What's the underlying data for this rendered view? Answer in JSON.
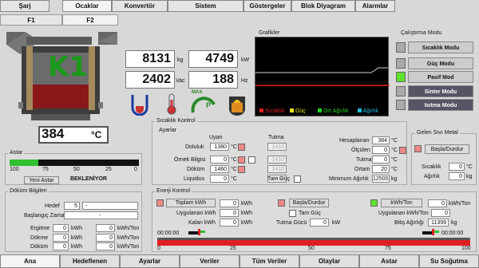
{
  "top_tabs": [
    "Şarj",
    "Ocaklar",
    "Konvertör",
    "Sistem",
    "Göstergeler",
    "Blok Diyagram",
    "Alarmlar"
  ],
  "sub_tabs": [
    "F1",
    "F2"
  ],
  "furnace": {
    "label": "K1",
    "temp": "384",
    "temp_unit": "°C"
  },
  "readouts": {
    "r1": "8131",
    "u1": "kg",
    "r2": "4749",
    "u2": "kW",
    "r3": "2402",
    "u3": "Vac",
    "r4": "188",
    "u4": "Hz"
  },
  "icon_labels": {
    "max": "MAX",
    "p": "P"
  },
  "graphics": {
    "title": "Grafikler",
    "legend": [
      "Sıcaklık",
      "Güç",
      "Ort.Ağırlık",
      "Ağırlık"
    ]
  },
  "mode": {
    "title": "Çalıştırma Modu",
    "buttons": [
      "Sıcaklık Modu",
      "Güç Modu",
      "Pasif Mod",
      "Sinter Modu",
      "Isıtma Modu"
    ]
  },
  "astar": {
    "title": "Astar",
    "ticks": [
      "100",
      "75",
      "50",
      "25",
      "0"
    ],
    "btn": "Yeni Astar",
    "status": "BEKLENİYOR"
  },
  "temp_ctrl": {
    "title": "Sıcaklık Kontrol",
    "sub": "Ayarlar",
    "col1": "Uyarı",
    "col2": "Tutma",
    "rows": [
      {
        "label": "Doluluk",
        "v1": "1380",
        "u": "°C",
        "v2": "1410"
      },
      {
        "label": "Örnek Bilgisi",
        "v1": "0",
        "u": "°C",
        "v2": "1410"
      },
      {
        "label": "Döküm",
        "v1": "1460",
        "u": "°C",
        "v2": "1410"
      },
      {
        "label": "Liquidus",
        "v1": "0",
        "u": "°C",
        "v2": "1410"
      }
    ],
    "right": [
      {
        "label": "Hesaplanan",
        "v": "384",
        "u": "°C"
      },
      {
        "label": "Ölçülen",
        "v": "0",
        "u": "°C"
      },
      {
        "label": "Tutma",
        "v": "0",
        "u": "°C"
      },
      {
        "label": "Ortam",
        "v": "20",
        "u": "°C"
      },
      {
        "label": "Minimum Ağırlık",
        "v": "12500",
        "u": "kg"
      }
    ],
    "tam_guc": "Tam Güç"
  },
  "liquid": {
    "title": "Gelen Sıvı Metal",
    "btn": "Başla/Durdur",
    "sicaklik": "Sıcaklık",
    "sic_v": "0",
    "sic_u": "°C",
    "agirlik": "Ağırlık",
    "ag_v": "0",
    "ag_u": "kg"
  },
  "dokum": {
    "title": "Döküm Bilgileri",
    "hedef": "Hedef",
    "hedef_v": "5",
    "hedef_d": "-",
    "baslangic": "Başlangıç Zamanı",
    "baslangic_d": "-",
    "rows": [
      {
        "label": "Ergitme",
        "v1": "0",
        "u1": "kWh",
        "v2": "0",
        "u2": "kWh/Ton"
      },
      {
        "label": "Dökme",
        "v1": "0",
        "u1": "kWh",
        "v2": "0",
        "u2": "kWh/Ton"
      },
      {
        "label": "Döküm",
        "v1": "0",
        "u1": "kWh",
        "v2": "0",
        "u2": "kWh/Ton"
      }
    ]
  },
  "energy": {
    "title": "Enerji Kontrol",
    "toplam": "Toplam kWh",
    "toplam_v": "0",
    "toplam_u": "kWh",
    "basla": "Başla/Durdur",
    "kwh_ton": "kWh/Ton",
    "kwh_ton_v": "0",
    "kwh_ton_u": "kWh/Ton",
    "uyg": "Uygulanan kWh",
    "uyg_v": "0",
    "uyg_u": "kWh",
    "tam_guc": "Tam Güç",
    "uyg_ton": "Uygulanan kWh/Ton",
    "uyg_ton_v": "0",
    "kalan": "Kalan kWh",
    "kalan_v": "0",
    "kalan_u": "kWh",
    "tutma": "Tutma Gücü",
    "tutma_v": "0",
    "tutma_u": "kW",
    "bitis": "Bitiş Ağırlığı",
    "bitis_v": "11399",
    "bitis_u": "kg",
    "time1": "00:00:00",
    "time2": "00:00:00",
    "scale": [
      "0",
      "25",
      "50",
      "75",
      "100"
    ]
  },
  "bottom_tabs": [
    "Ana",
    "Hedeflenen",
    "Ayarlar",
    "Veriler",
    "Tüm Veriler",
    "Olaylar",
    "Astar",
    "Su Soğutma"
  ]
}
